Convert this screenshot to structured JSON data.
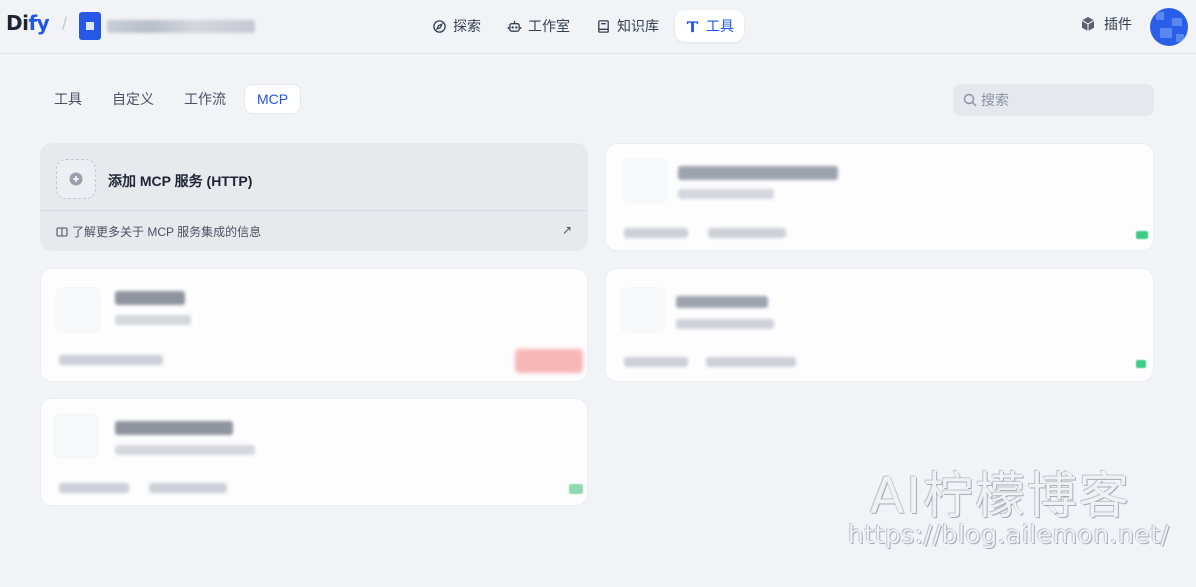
{
  "header": {
    "logo_main": "Di",
    "logo_accent": "fy",
    "workspace_name": "",
    "nav": [
      {
        "label": "探索",
        "icon": "compass-icon"
      },
      {
        "label": "工作室",
        "icon": "robot-icon"
      },
      {
        "label": "知识库",
        "icon": "book-icon"
      },
      {
        "label": "工具",
        "icon": "tool-icon",
        "active": true
      }
    ],
    "plugins_label": "插件"
  },
  "tabs": [
    {
      "label": "工具"
    },
    {
      "label": "自定义"
    },
    {
      "label": "工作流"
    },
    {
      "label": "MCP",
      "active": true
    }
  ],
  "search": {
    "placeholder": "搜索"
  },
  "add_card": {
    "title": "添加 MCP 服务 (HTTP)",
    "link": "了解更多关于 MCP 服务集成的信息",
    "link_arrow": "↗"
  },
  "watermark": {
    "title": "AI柠檬博客",
    "url": "https://blog.ailemon.net/"
  },
  "colors": {
    "accent": "#1f55e8",
    "background": "#f2f3f7",
    "status_green": "#3ccc86",
    "status_red": "#f7b6b6"
  }
}
